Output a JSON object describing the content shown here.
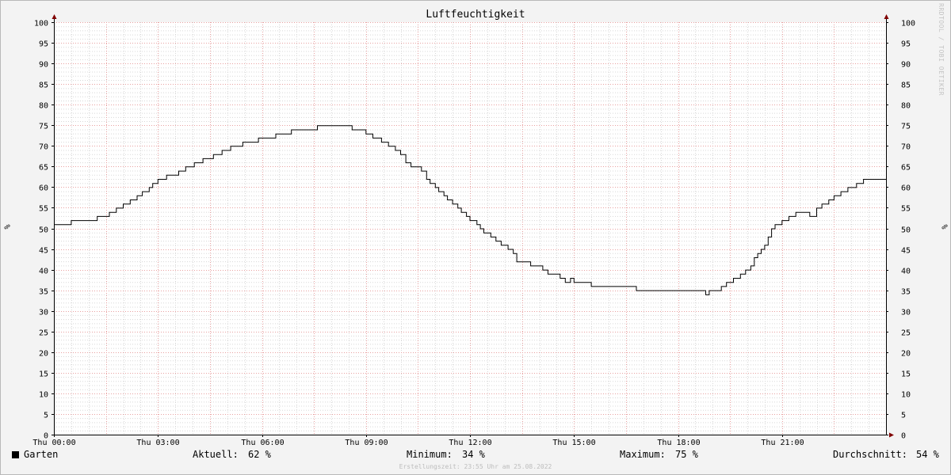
{
  "chart_data": {
    "type": "line",
    "title": "Luftfeuchtigkeit",
    "ylabel": "%",
    "ylim": [
      0,
      100
    ],
    "y_ticks": [
      0,
      5,
      10,
      15,
      20,
      25,
      30,
      35,
      40,
      45,
      50,
      55,
      60,
      65,
      70,
      75,
      80,
      85,
      90,
      95,
      100
    ],
    "xlim_hours": [
      0,
      24
    ],
    "x_ticks": [
      {
        "hour": 0,
        "label": "Thu 00:00"
      },
      {
        "hour": 3,
        "label": "Thu 03:00"
      },
      {
        "hour": 6,
        "label": "Thu 06:00"
      },
      {
        "hour": 9,
        "label": "Thu 09:00"
      },
      {
        "hour": 12,
        "label": "Thu 12:00"
      },
      {
        "hour": 15,
        "label": "Thu 15:00"
      },
      {
        "hour": 18,
        "label": "Thu 18:00"
      },
      {
        "hour": 21,
        "label": "Thu 21:00"
      }
    ],
    "grid": true,
    "series": [
      {
        "name": "Garten",
        "color": "#000000",
        "step": true,
        "points": [
          [
            0.0,
            51
          ],
          [
            0.5,
            52
          ],
          [
            1.25,
            53
          ],
          [
            1.6,
            54
          ],
          [
            1.8,
            55
          ],
          [
            2.0,
            56
          ],
          [
            2.2,
            57
          ],
          [
            2.4,
            58
          ],
          [
            2.55,
            59
          ],
          [
            2.75,
            60
          ],
          [
            2.85,
            61
          ],
          [
            3.0,
            62
          ],
          [
            3.25,
            63
          ],
          [
            3.6,
            64
          ],
          [
            3.8,
            65
          ],
          [
            4.05,
            66
          ],
          [
            4.3,
            67
          ],
          [
            4.6,
            68
          ],
          [
            4.85,
            69
          ],
          [
            5.1,
            70
          ],
          [
            5.45,
            71
          ],
          [
            5.9,
            72
          ],
          [
            6.4,
            73
          ],
          [
            6.85,
            74
          ],
          [
            7.6,
            75
          ],
          [
            8.6,
            74
          ],
          [
            9.0,
            73
          ],
          [
            9.2,
            72
          ],
          [
            9.45,
            71
          ],
          [
            9.65,
            70
          ],
          [
            9.85,
            69
          ],
          [
            10.0,
            68
          ],
          [
            10.15,
            66
          ],
          [
            10.3,
            65
          ],
          [
            10.6,
            64
          ],
          [
            10.75,
            62
          ],
          [
            10.85,
            61
          ],
          [
            11.0,
            60
          ],
          [
            11.1,
            59
          ],
          [
            11.25,
            58
          ],
          [
            11.35,
            57
          ],
          [
            11.5,
            56
          ],
          [
            11.65,
            55
          ],
          [
            11.75,
            54
          ],
          [
            11.9,
            53
          ],
          [
            12.0,
            52
          ],
          [
            12.2,
            51
          ],
          [
            12.3,
            50
          ],
          [
            12.4,
            49
          ],
          [
            12.6,
            48
          ],
          [
            12.75,
            47
          ],
          [
            12.9,
            46
          ],
          [
            13.1,
            45
          ],
          [
            13.25,
            44
          ],
          [
            13.35,
            42
          ],
          [
            13.75,
            41
          ],
          [
            14.1,
            40
          ],
          [
            14.25,
            39
          ],
          [
            14.6,
            38
          ],
          [
            14.75,
            37
          ],
          [
            14.9,
            38
          ],
          [
            15.0,
            37
          ],
          [
            15.5,
            36
          ],
          [
            16.8,
            35
          ],
          [
            18.8,
            34
          ],
          [
            18.9,
            35
          ],
          [
            19.25,
            36
          ],
          [
            19.4,
            37
          ],
          [
            19.6,
            38
          ],
          [
            19.8,
            39
          ],
          [
            19.95,
            40
          ],
          [
            20.1,
            41
          ],
          [
            20.2,
            43
          ],
          [
            20.3,
            44
          ],
          [
            20.4,
            45
          ],
          [
            20.5,
            46
          ],
          [
            20.6,
            48
          ],
          [
            20.7,
            50
          ],
          [
            20.8,
            51
          ],
          [
            21.0,
            52
          ],
          [
            21.2,
            53
          ],
          [
            21.4,
            54
          ],
          [
            21.8,
            53
          ],
          [
            22.0,
            55
          ],
          [
            22.15,
            56
          ],
          [
            22.35,
            57
          ],
          [
            22.5,
            58
          ],
          [
            22.7,
            59
          ],
          [
            22.9,
            60
          ],
          [
            23.15,
            61
          ],
          [
            23.35,
            62
          ],
          [
            24.0,
            62
          ]
        ]
      }
    ]
  },
  "legend": {
    "series_name": "Garten",
    "current_label": "Aktuell:",
    "current_value": "62 %",
    "min_label": "Minimum:",
    "min_value": "34 %",
    "max_label": "Maximum:",
    "max_value": "75 %",
    "avg_label": "Durchschnitt:",
    "avg_value": "54 %"
  },
  "watermark": "RRDTOOL / TOBI OETIKER",
  "created": "Erstellungszeit: 23:55 Uhr am 25.08.2022",
  "colors": {
    "background": "#f3f3f3",
    "plot_background": "#ffffff",
    "minor_grid": "#d8d8d8",
    "major_grid": "#e8a0a0",
    "axis": "#000000",
    "arrow": "#800000",
    "line": "#000000"
  }
}
